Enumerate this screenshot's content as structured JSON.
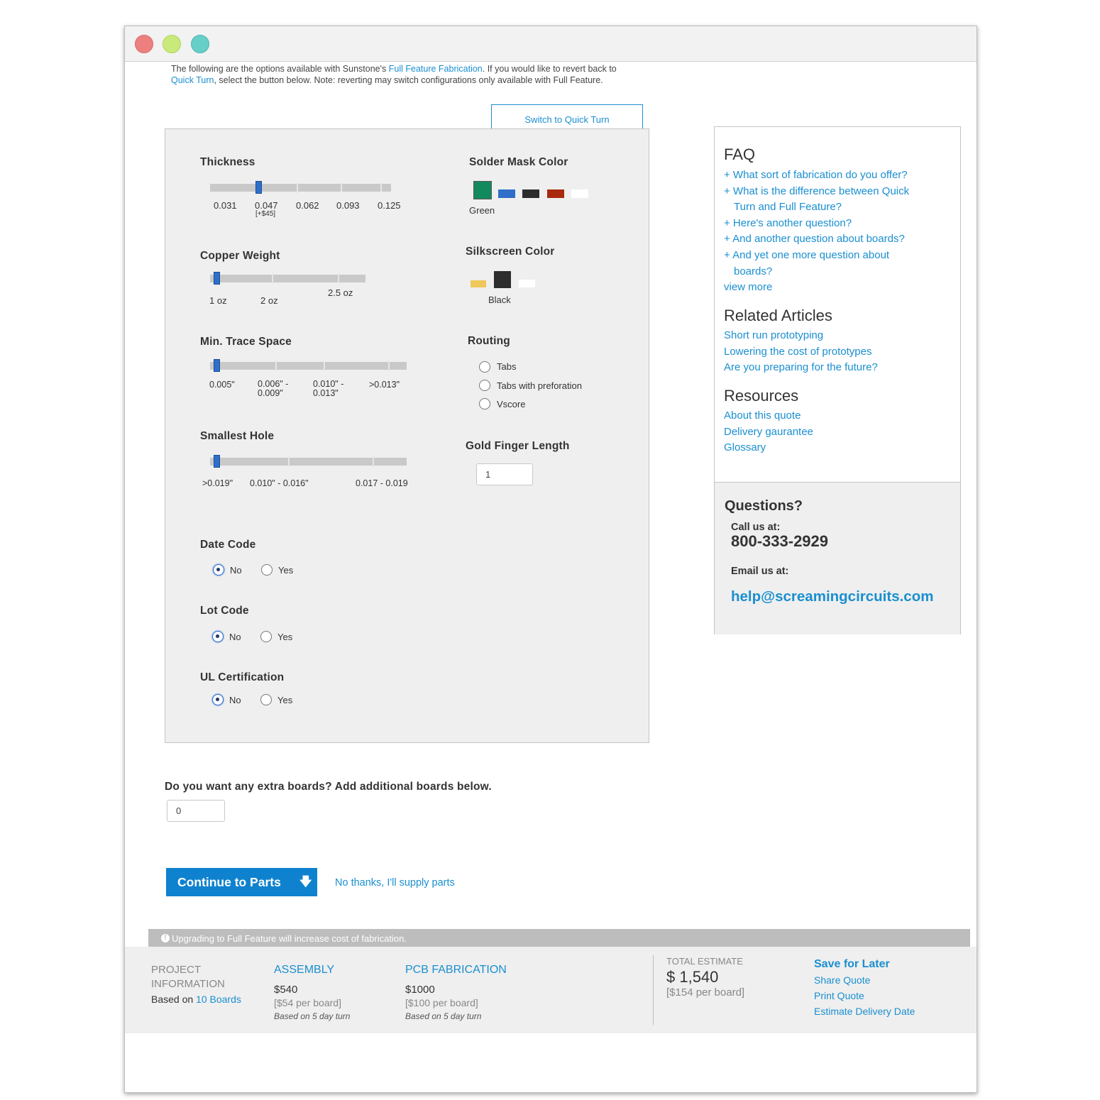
{
  "intro": {
    "text_1": "The following are the options available with Sunstone's ",
    "link_full_feature": "Full Feature Fabrication",
    "text_2": ". If you would like to revert back to ",
    "link_quick_turn": "Quick Turn",
    "text_3": ", select the button below. Note: reverting may switch configurations only available with Full Feature."
  },
  "switch_button": "Switch to Quick Turn",
  "options": {
    "thickness": {
      "label": "Thickness",
      "ticks": [
        "0.031",
        "0.047",
        "0.062",
        "0.093",
        "0.125"
      ],
      "price_note": "[+$45]",
      "selected_value": "0.047"
    },
    "copper_weight": {
      "label": "Copper Weight",
      "ticks": [
        "1 oz",
        "2 oz",
        "2.5 oz"
      ],
      "selected_value": "1 oz"
    },
    "min_trace_space": {
      "label": "Min. Trace Space",
      "ticks": [
        "0.005\"",
        "0.006\" -",
        "0.009\"",
        "0.010\" -",
        "0.013\"",
        ">0.013\""
      ],
      "selected_value": "0.005\""
    },
    "smallest_hole": {
      "label": "Smallest Hole",
      "ticks": [
        ">0.019\"",
        "0.010\" - 0.016\"",
        "0.017 - 0.019"
      ],
      "selected_value": ">0.019\""
    },
    "solder_mask": {
      "label": "Solder Mask Color",
      "selected_name": "Green",
      "colors": [
        "#138a5e",
        "#2f6fc9",
        "#2d2d2d",
        "#a9290f",
        "#ffffff"
      ]
    },
    "silkscreen": {
      "label": "Silkscreen Color",
      "selected_name": "Black",
      "colors": [
        "#efc75a",
        "#2d2d2d",
        "#ffffff"
      ]
    },
    "routing": {
      "label": "Routing",
      "options": [
        "Tabs",
        "Tabs with preforation",
        "Vscore"
      ]
    },
    "gold_finger": {
      "label": "Gold Finger Length",
      "value": "1"
    },
    "date_code": {
      "label": "Date Code",
      "no": "No",
      "yes": "Yes",
      "selected": "No"
    },
    "lot_code": {
      "label": "Lot Code",
      "no": "No",
      "yes": "Yes",
      "selected": "No"
    },
    "ul_cert": {
      "label": "UL Certification",
      "no": "No",
      "yes": "Yes",
      "selected": "No"
    }
  },
  "extra_boards": {
    "question": "Do you want any extra boards? Add additional boards below.",
    "value": "0"
  },
  "actions": {
    "continue": "Continue to Parts",
    "no_thanks": "No thanks, I'll supply parts"
  },
  "sidebar": {
    "faq_title": "FAQ",
    "faq": [
      "+ What sort of fabrication do you offer?",
      "+ What is the difference between Quick",
      "Turn and Full Feature?",
      "+ Here's another question?",
      "+ And another question about boards?",
      "+ And yet one more question about",
      "boards?"
    ],
    "view_more": "view more",
    "related_title": "Related Articles",
    "related": [
      "Short run prototyping",
      "Lowering the cost of prototypes",
      "Are you preparing for the future?"
    ],
    "resources_title": "Resources",
    "resources": [
      "About this quote",
      "Delivery gaurantee",
      "Glossary"
    ],
    "questions_title": "Questions?",
    "call_label": "Call us at:",
    "phone": "800-333-2929",
    "email_label": "Email us at:",
    "email": "help@screamingcircuits.com"
  },
  "notice": "Upgrading to Full Feature will increase cost of fabrication.",
  "footer": {
    "project_label_1": "PROJECT",
    "project_label_2": "INFORMATION",
    "based_on": "Based on ",
    "boards_link": "10 Boards",
    "assembly": {
      "title": "ASSEMBLY",
      "price": "$540",
      "per_board": "[$54 per board]",
      "note": "Based on 5 day turn"
    },
    "pcb": {
      "title": "PCB FABRICATION",
      "price": "$1000",
      "per_board": "[$100 per board]",
      "note": "Based on 5 day turn"
    },
    "total": {
      "label": "TOTAL ESTIMATE",
      "price": "$ 1,540",
      "per_board": "[$154 per board]"
    },
    "links": {
      "save": "Save for Later",
      "share": "Share Quote",
      "print": "Print Quote",
      "delivery": "Estimate Delivery Date"
    }
  },
  "colors": {
    "accent": "#1a8fd0",
    "button": "#0f82cf",
    "knob": "#2d6fc9"
  }
}
